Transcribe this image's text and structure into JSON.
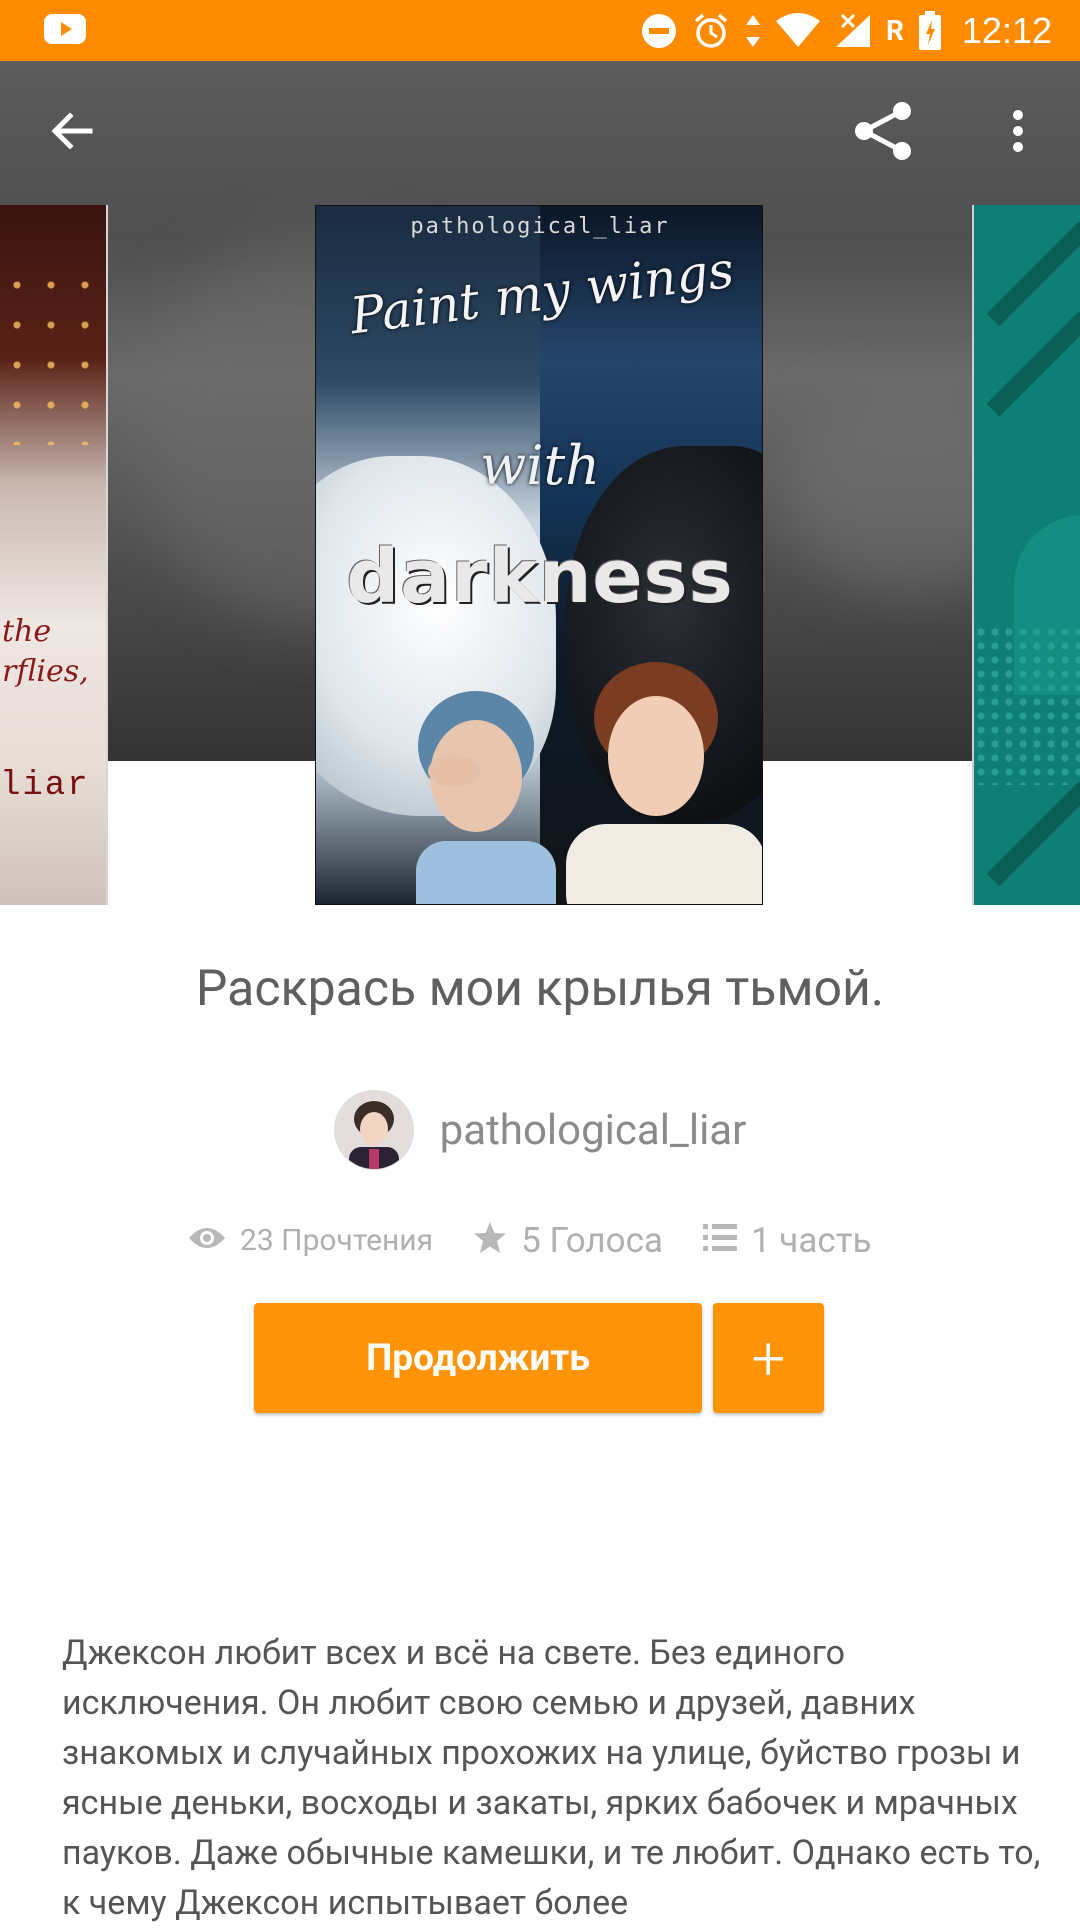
{
  "status_bar": {
    "time": "12:12",
    "color": "#ff8c00",
    "icons": [
      "youtube-icon",
      "dnd-icon",
      "alarm-icon",
      "data-arrows-icon",
      "wifi-icon",
      "signal-icon",
      "roaming-icon",
      "battery-icon"
    ],
    "roaming_letter": "R"
  },
  "toolbar": {
    "icons": [
      "back-arrow-icon",
      "share-icon",
      "more-vert-icon"
    ]
  },
  "cover": {
    "author": "pathological_liar",
    "title_line1": "Paint my wings",
    "title_line2": "with",
    "title_line3": "darkness",
    "left_cover_text1": "the",
    "left_cover_text2": "rflies,",
    "left_cover_text3": "liar"
  },
  "story": {
    "title": "Раскрась мои крылья тьмой.",
    "author": "pathological_liar",
    "stats": {
      "reads": "23 Прочтения",
      "votes": "5 Голоса",
      "parts": "1 часть"
    },
    "continue_label": "Продолжить",
    "add_label": "+",
    "description": "Джексон любит всех и всё на свете. Без единого исключения. Он любит свою семью и друзей, давних знакомых и случайных прохожих на улице, буйство грозы и ясные деньки, восходы и закаты, ярких бабочек и мрачных пауков. Даже обычные камешки, и те любит. Однако есть то, к чему Джексон испытывает более"
  },
  "colors": {
    "accent": "#ff9409",
    "title_text": "#5f5f5f",
    "stat_text": "#b0b0b0"
  }
}
